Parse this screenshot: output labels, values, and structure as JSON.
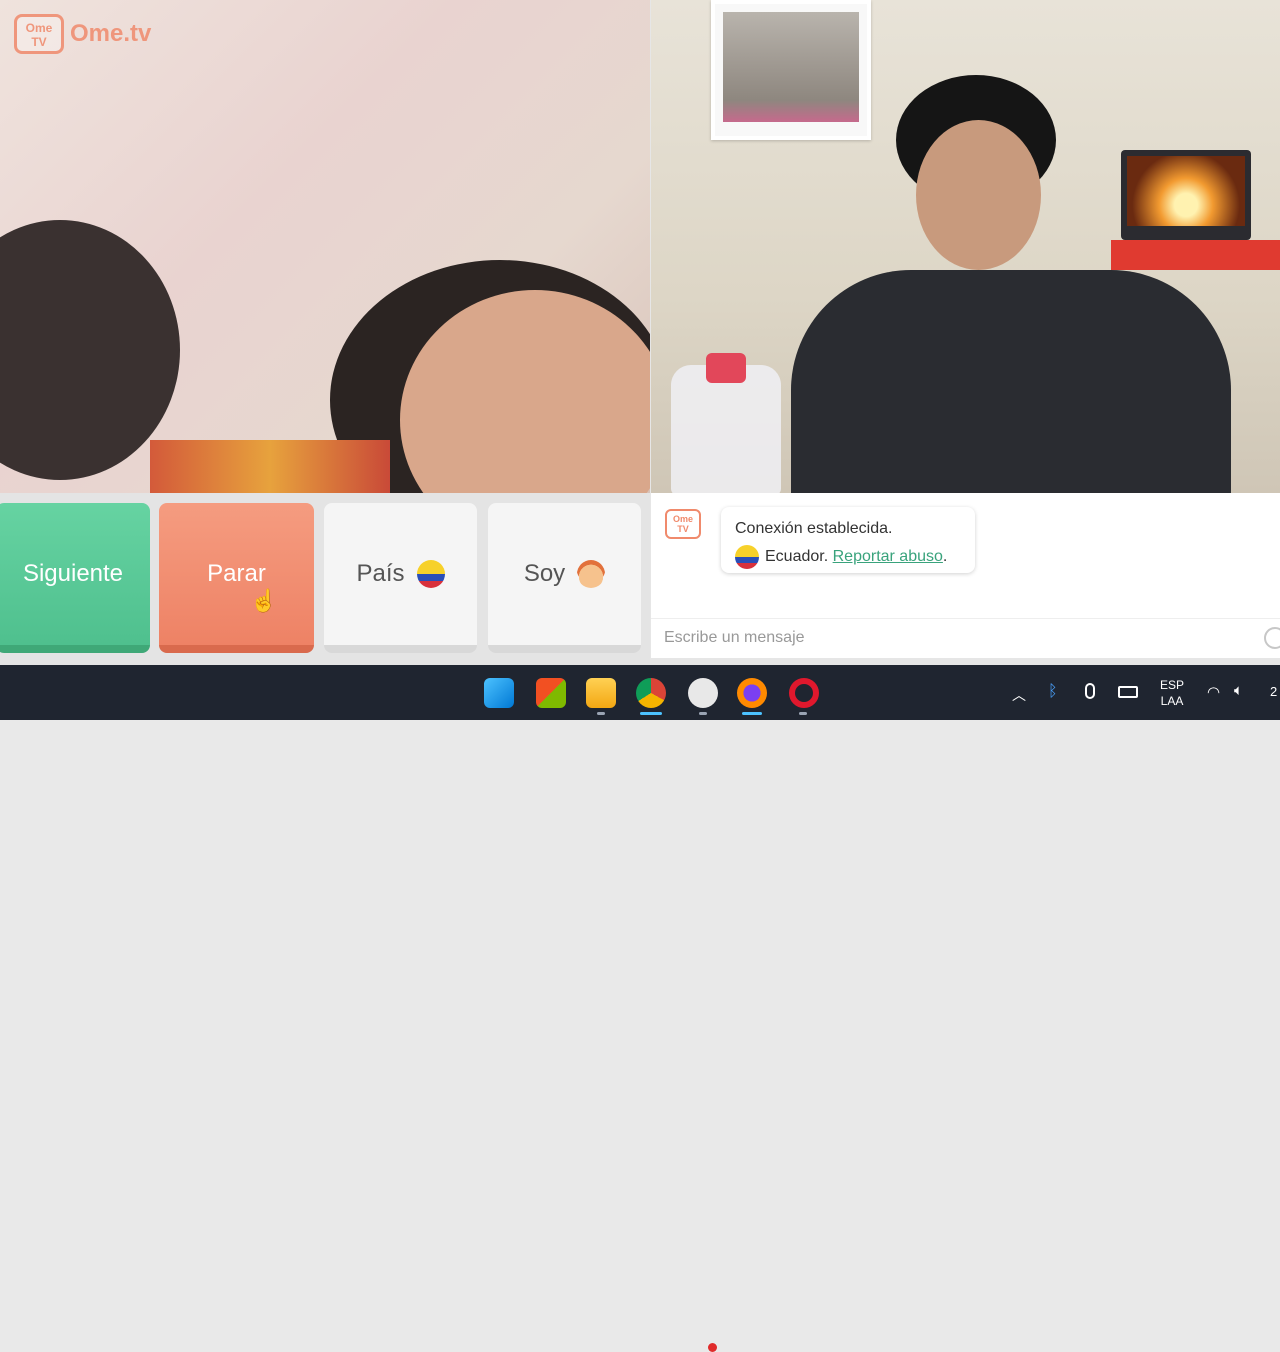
{
  "brand": {
    "logo_text": "Ome TV",
    "name": "Ome.tv"
  },
  "controls": {
    "next_label": "Siguiente",
    "stop_label": "Parar",
    "country_label": "País",
    "soy_label": "Soy"
  },
  "chat": {
    "logo_text": "Ome TV",
    "message_line1": "Conexión establecida.",
    "country": "Ecuador.",
    "report_link": "Reportar abuso",
    "report_suffix": ".",
    "input_placeholder": "Escribe un mensaje"
  },
  "taskbar": {
    "apps": [
      "windows-start",
      "microsoft-store",
      "file-explorer",
      "chrome",
      "obs",
      "firefox",
      "opera"
    ],
    "lang_line1": "ESP",
    "lang_line2": "LAA",
    "clock_partial": "2"
  },
  "colors": {
    "next": "#58c896",
    "stop": "#f08a6c",
    "brand": "#f08a6c",
    "link": "#39a37c",
    "taskbar": "#1f2530"
  }
}
